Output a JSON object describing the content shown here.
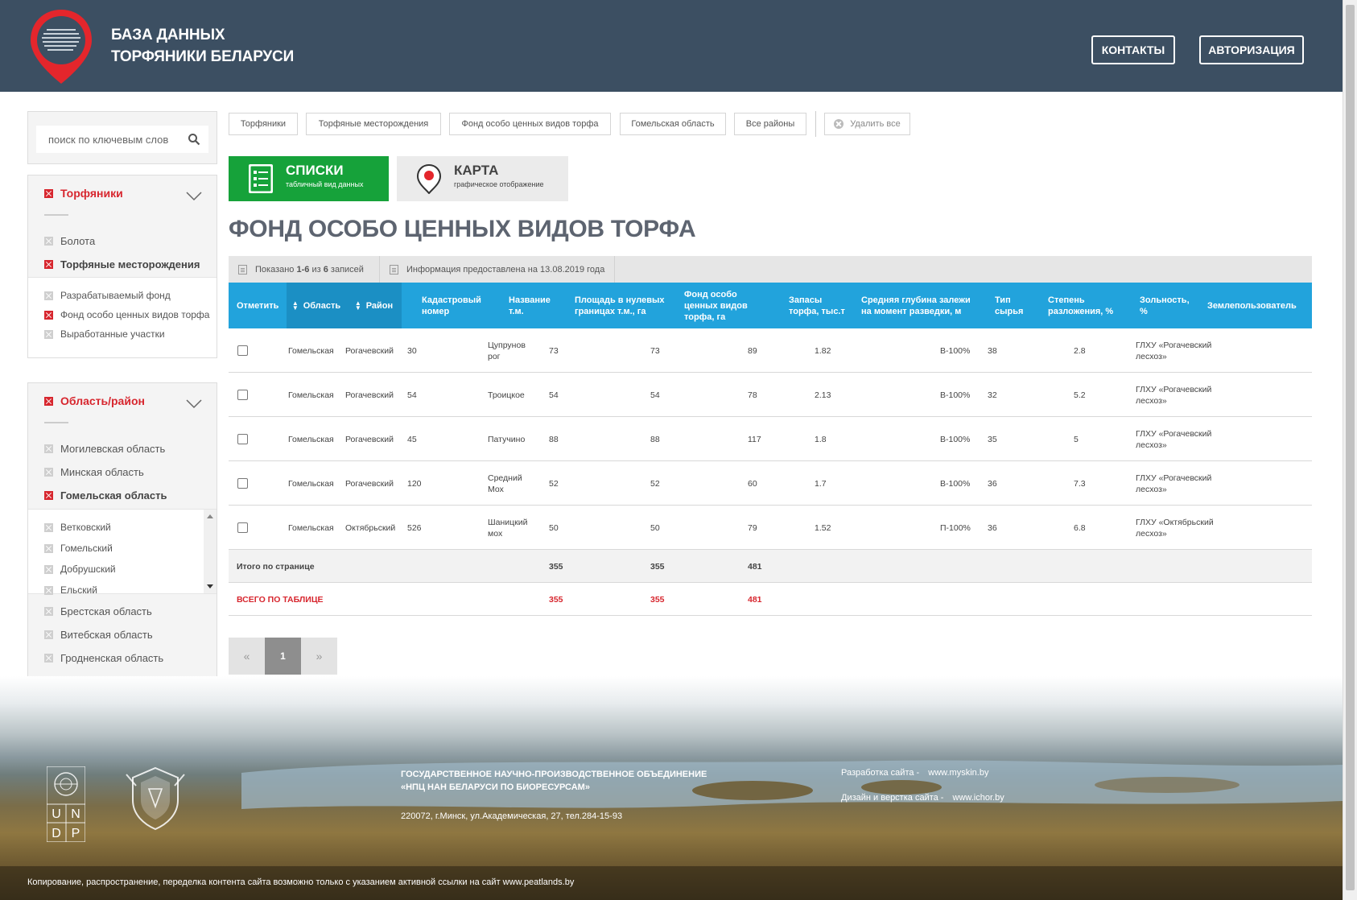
{
  "header": {
    "title_line1": "БАЗА ДАННЫХ",
    "title_line2": "ТОРФЯНИКИ БЕЛАРУСИ",
    "contacts_label": "КОНТАКТЫ",
    "auth_label": "АВТОРИЗАЦИЯ"
  },
  "search": {
    "placeholder": "поиск по ключевым слов"
  },
  "filters": {
    "group1": {
      "title": "Торфяники",
      "items": [
        "Болота",
        "Торфяные месторождения"
      ],
      "subitems": [
        "Разрабатываемый фонд",
        "Фонд особо ценных видов торфа",
        "Выработанные участки"
      ]
    },
    "group2": {
      "title": "Область/район",
      "items": [
        "Могилевская область",
        "Минская область",
        "Гомельская область"
      ],
      "subitems": [
        "Ветковский",
        "Гомельский",
        "Добрушский",
        "Ельский"
      ],
      "items_after": [
        "Брестская область",
        "Витебская область",
        "Гродненская область"
      ]
    }
  },
  "tags": [
    "Торфяники",
    "Торфяные месторождения",
    "Фонд особо ценных видов торфа",
    "Гомельская область",
    "Все районы"
  ],
  "clear_all_label": "Удалить все",
  "views": {
    "list_title": "СПИСКИ",
    "list_sub": "табличный вид данных",
    "map_title": "КАРТА",
    "map_sub": "графическое отображение"
  },
  "page_title": "ФОНД ОСОБО ЦЕННЫХ ВИДОВ ТОРФА",
  "info": {
    "shown_prefix": "Показано ",
    "shown_range": "1-6",
    "shown_mid": " из ",
    "shown_total": "6",
    "shown_suffix": " записей",
    "provided": "Информация предоставлена на 13.08.2019 года"
  },
  "table": {
    "headers": {
      "mark": "Отметить",
      "region": "Область",
      "district": "Район",
      "cadastral": "Кадастровый номер",
      "name": "Название т.м.",
      "area": "Площадь в нулевых границах т.м., га",
      "fund": "Фонд особо ценных видов торфа, га",
      "reserves": "Запасы торфа, тыс.т",
      "depth": "Средняя глубина залежи на момент разведки, м",
      "type": "Тип сырья",
      "decomp": "Степень разложения, %",
      "ash": "Зольность, %",
      "owner": "Землепользователь"
    },
    "rows": [
      {
        "region": "Гомельская",
        "district": "Рогачевский",
        "cadastral": "30",
        "name": "Цупрунов рог",
        "area": "73",
        "fund": "73",
        "reserves": "89",
        "depth": "1.82",
        "type": "В-100%",
        "decomp": "38",
        "ash": "2.8",
        "owner": "ГЛХУ «Рогачевский лесхоз»"
      },
      {
        "region": "Гомельская",
        "district": "Рогачевский",
        "cadastral": "54",
        "name": "Троицкое",
        "area": "54",
        "fund": "54",
        "reserves": "78",
        "depth": "2.13",
        "type": "В-100%",
        "decomp": "32",
        "ash": "5.2",
        "owner": "ГЛХУ «Рогачевский лесхоз»"
      },
      {
        "region": "Гомельская",
        "district": "Рогачевский",
        "cadastral": "45",
        "name": "Патучино",
        "area": "88",
        "fund": "88",
        "reserves": "117",
        "depth": "1.8",
        "type": "В-100%",
        "decomp": "35",
        "ash": "5",
        "owner": "ГЛХУ «Рогачевский лесхоз»"
      },
      {
        "region": "Гомельская",
        "district": "Рогачевский",
        "cadastral": "120",
        "name": "Средний Мох",
        "area": "52",
        "fund": "52",
        "reserves": "60",
        "depth": "1.7",
        "type": "В-100%",
        "decomp": "36",
        "ash": "7.3",
        "owner": "ГЛХУ «Рогачевский лесхоз»"
      },
      {
        "region": "Гомельская",
        "district": "Октябрьский",
        "cadastral": "526",
        "name": "Шаницкий мох",
        "area": "50",
        "fund": "50",
        "reserves": "79",
        "depth": "1.52",
        "type": "П-100%",
        "decomp": "36",
        "ash": "6.8",
        "owner": "ГЛХУ «Октябрьский лесхоз»"
      }
    ],
    "page_total": {
      "label": "Итого по странице",
      "area": "355",
      "fund": "355",
      "reserves": "481"
    },
    "grand_total": {
      "label": "ВСЕГО ПО ТАБЛИЦЕ",
      "area": "355",
      "fund": "355",
      "reserves": "481"
    }
  },
  "pagination": {
    "prev": "«",
    "current": "1",
    "next": "»"
  },
  "footer": {
    "org_line1": "ГОСУДАРСТВЕННОЕ НАУЧНО-ПРОИЗВОДСТВЕННОЕ ОБЪЕДИНЕНИЕ",
    "org_line2": "«НПЦ НАН БЕЛАРУСИ ПО БИОРЕСУРСАМ»",
    "address": "220072, г.Минск, ул.Академическая, 27, тел.284-15-93",
    "dev_label": "Разработка сайта -",
    "dev_link": "www.myskin.by",
    "design_label": "Дизайн и верстка сайта -",
    "design_link": "www.ichor.by",
    "copyright": "Копирование, распространение, переделка контента сайта возможно только с указанием активной ссылки на сайт   www.peatlands.by",
    "undp_letters": [
      "U",
      "N",
      "D",
      "P"
    ]
  },
  "colors": {
    "header_bg": "#3c4f62",
    "accent_red": "#d7262e",
    "table_head": "#22a3dc",
    "list_green": "#16a23a"
  }
}
